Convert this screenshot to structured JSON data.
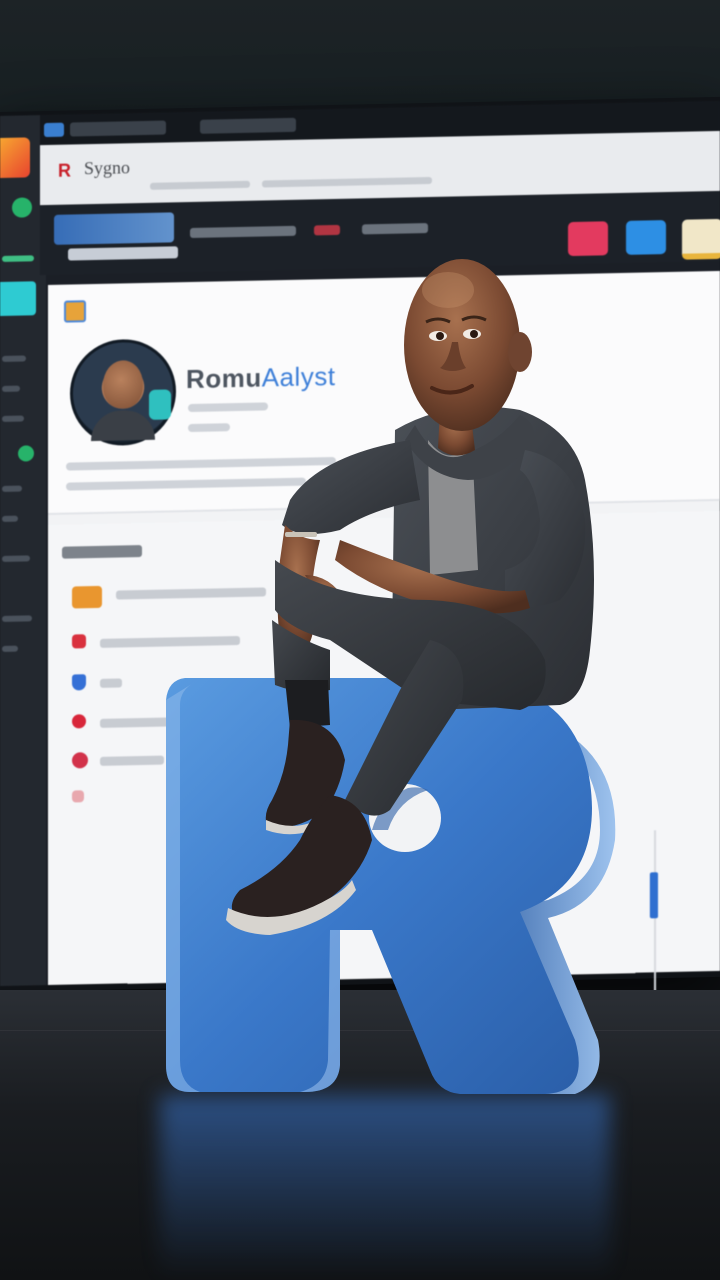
{
  "brand": {
    "name_part1": "Romu",
    "name_part2": "Aalyst",
    "url_icon": "R",
    "url_title": "Sygno"
  },
  "colors": {
    "accent_blue": "#3d7fd8",
    "letter_blue": "#3a78c9",
    "teal": "#2ecbd2",
    "hoodie": "#3b3f44"
  },
  "icons": {
    "sidebar_logo": "app-logo-icon",
    "profile_avatar": "avatar-image",
    "sculpture": "letter-r-sculpture"
  }
}
